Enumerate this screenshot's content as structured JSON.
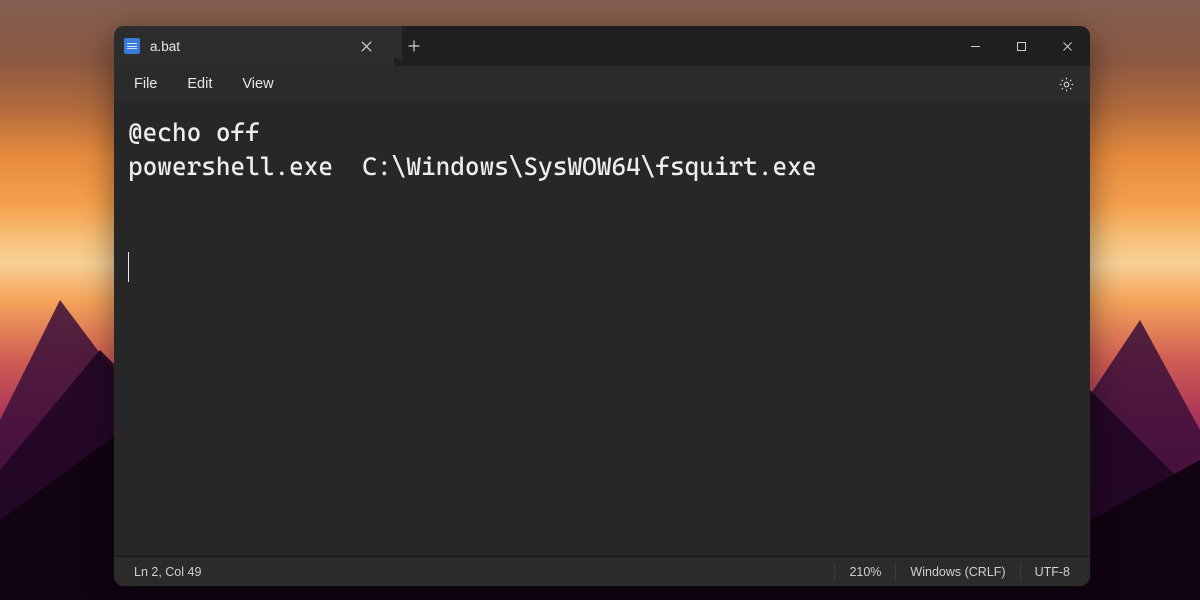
{
  "titlebar": {
    "tab_title": "a.bat"
  },
  "menu": {
    "file": "File",
    "edit": "Edit",
    "view": "View"
  },
  "editor": {
    "lines": [
      "@echo off",
      "powershell.exe  C:\\Windows\\SysWOW64\\fsquirt.exe"
    ]
  },
  "status": {
    "position": "Ln 2, Col 49",
    "zoom": "210%",
    "line_ending": "Windows (CRLF)",
    "encoding": "UTF-8"
  }
}
